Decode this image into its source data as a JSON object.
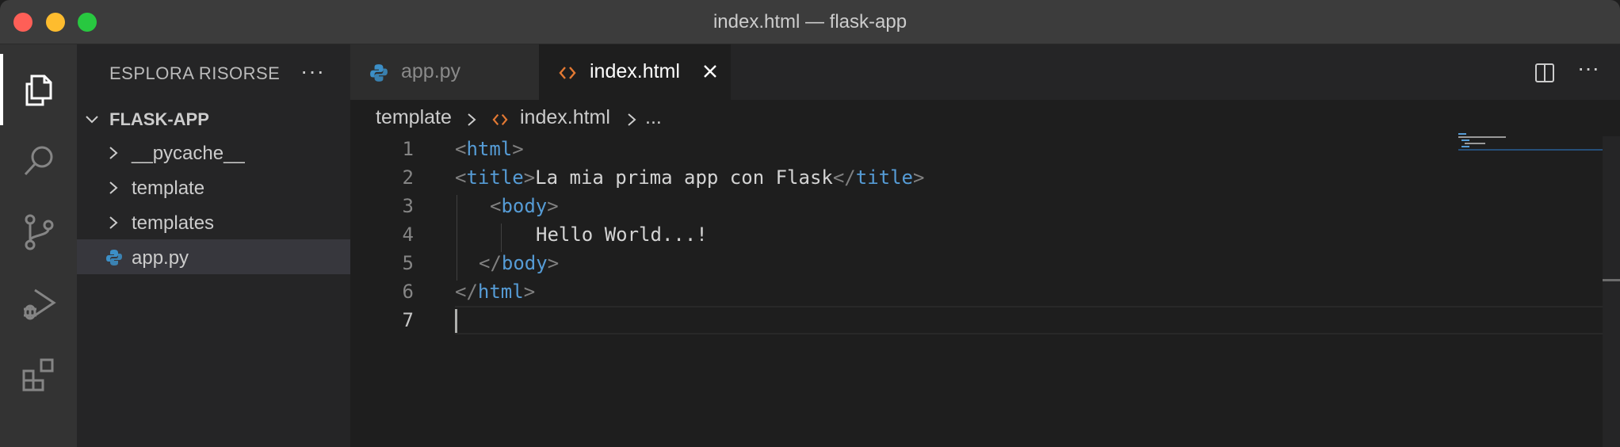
{
  "window": {
    "title": "index.html — flask-app"
  },
  "activity_bar": {
    "items": [
      {
        "icon": "files-icon",
        "active": true
      },
      {
        "icon": "search-icon",
        "active": false
      },
      {
        "icon": "source-control-icon",
        "active": false
      },
      {
        "icon": "run-debug-icon",
        "active": false
      },
      {
        "icon": "extensions-icon",
        "active": false
      }
    ]
  },
  "sidebar": {
    "header": "ESPLORA RISORSE",
    "more": "···",
    "root": "FLASK-APP",
    "items": [
      {
        "label": "__pycache__",
        "type": "folder"
      },
      {
        "label": "template",
        "type": "folder"
      },
      {
        "label": "templates",
        "type": "folder"
      },
      {
        "label": "app.py",
        "type": "python-file",
        "selected": true
      }
    ]
  },
  "tabs": [
    {
      "label": "app.py",
      "icon": "python-icon",
      "active": false
    },
    {
      "label": "index.html",
      "icon": "html-icon",
      "active": true
    }
  ],
  "tab_actions": {
    "more": "···"
  },
  "breadcrumbs": {
    "folder": "template",
    "file": "index.html",
    "rest": "..."
  },
  "editor": {
    "line_numbers": [
      "1",
      "2",
      "3",
      "4",
      "5",
      "6",
      "7"
    ],
    "code": {
      "l1": {
        "open": "<",
        "tag": "html",
        "close": ">"
      },
      "l2": {
        "open": "<",
        "tag": "title",
        "close": ">",
        "text": "La mia prima app con Flask",
        "end_open": "</",
        "end_tag": "title",
        "end_close": ">"
      },
      "l3": {
        "open": "<",
        "tag": "body",
        "close": ">"
      },
      "l4": {
        "text": "Hello World...!"
      },
      "l5": {
        "open": "</",
        "tag": "body",
        "close": ">"
      },
      "l6": {
        "open": "</",
        "tag": "html",
        "close": ">"
      }
    }
  },
  "colors": {
    "accent_html": "#e37933",
    "python_blue": "#3c8fc7",
    "tag_blue": "#569cd6"
  }
}
